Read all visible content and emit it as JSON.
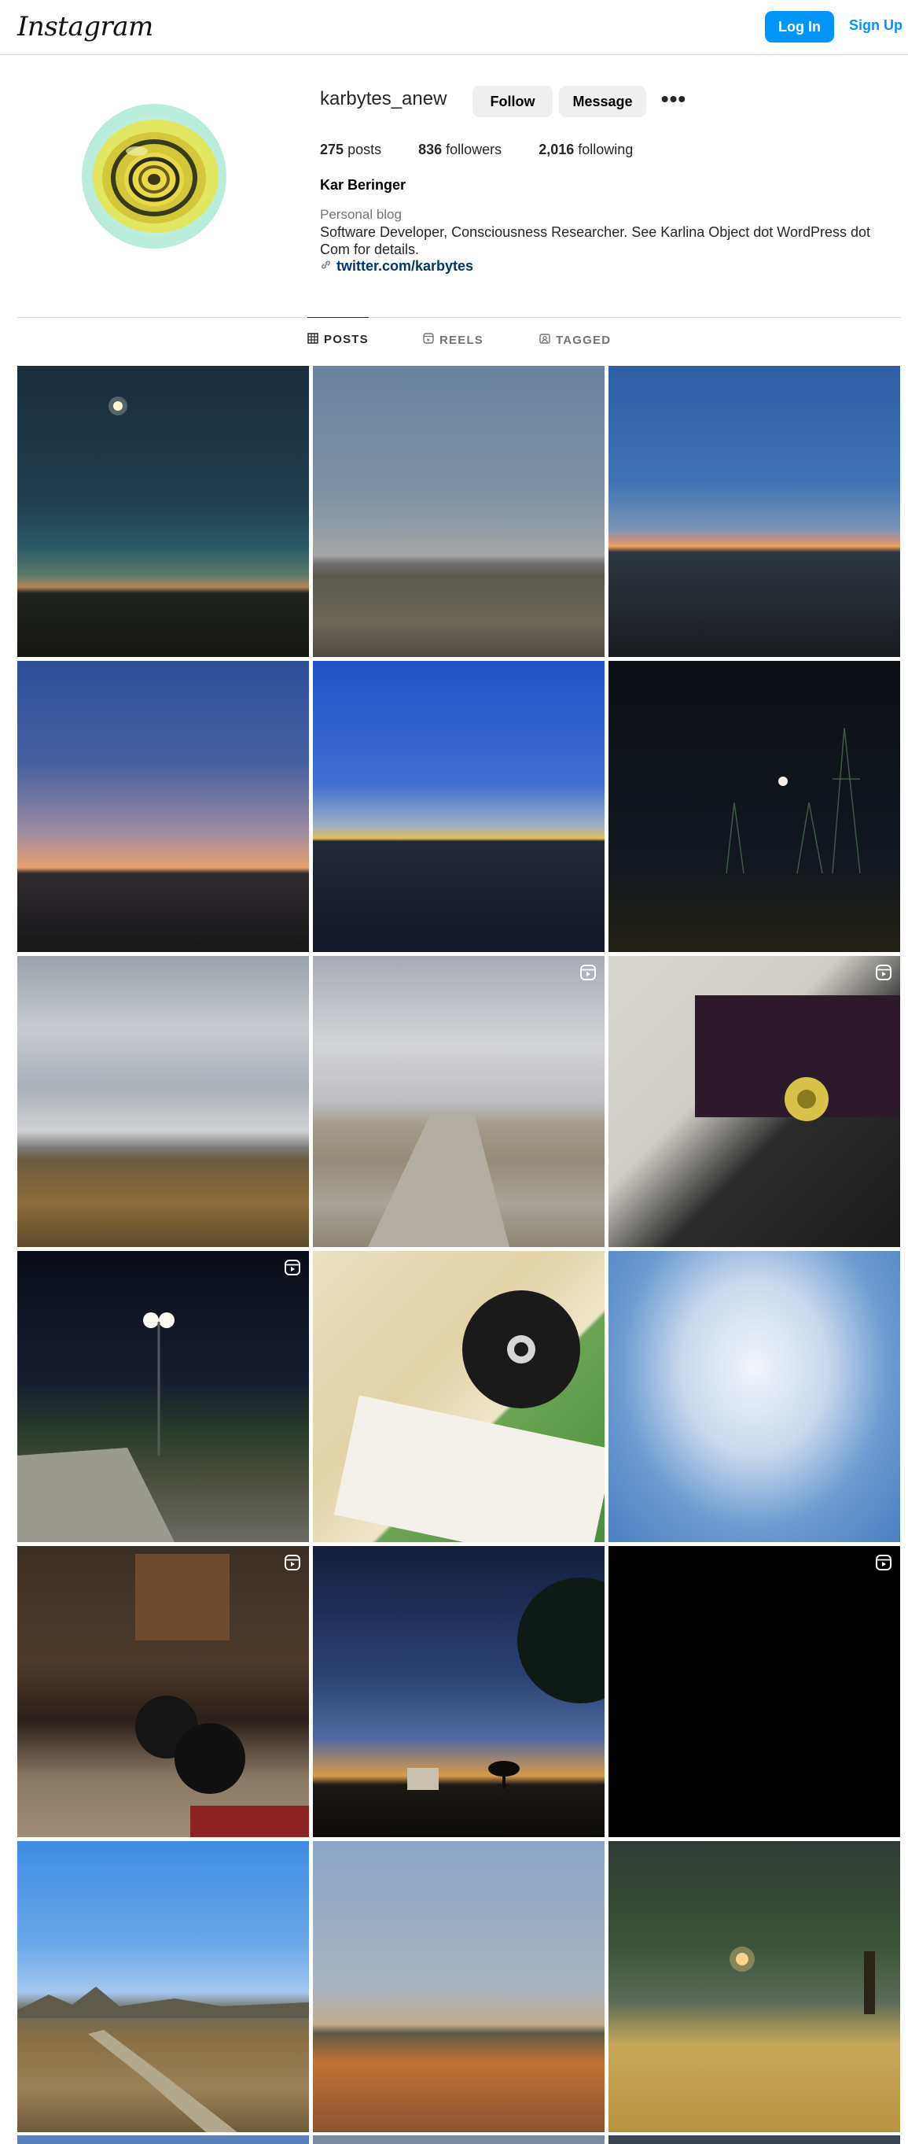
{
  "header": {
    "logo_text": "Instagram",
    "login_label": "Log In",
    "signup_label": "Sign Up",
    "accent_color": "#0095f6"
  },
  "profile": {
    "username": "karbytes_anew",
    "follow_label": "Follow",
    "message_label": "Message",
    "more_icon": "more-horizontal-icon",
    "stats": {
      "posts_count": "275",
      "posts_label": "posts",
      "followers_count": "836",
      "followers_label": "followers",
      "following_count": "2,016",
      "following_label": "following"
    },
    "full_name": "Kar Beringer",
    "category": "Personal blog",
    "bio": "Software Developer, Consciousness Researcher. See Karlina Object dot WordPress dot Com for details.",
    "link": "twitter.com/karbytes"
  },
  "tabs": [
    {
      "label": "POSTS",
      "icon": "grid-icon",
      "active": true
    },
    {
      "label": "REELS",
      "icon": "reels-icon",
      "active": false
    },
    {
      "label": "TAGGED",
      "icon": "tagged-icon",
      "active": false
    }
  ],
  "posts": [
    {
      "scene": "night-sky-moon-horizon",
      "is_reel": false
    },
    {
      "scene": "dusk-field-mountains",
      "is_reel": false
    },
    {
      "scene": "blue-sky-sunset-horizon",
      "is_reel": false
    },
    {
      "scene": "sunset-gradient-horizon",
      "is_reel": false
    },
    {
      "scene": "blue-sky-golden-horizon",
      "is_reel": false
    },
    {
      "scene": "night-power-lines-moon",
      "is_reel": false
    },
    {
      "scene": "cloudy-sky-dry-fields",
      "is_reel": false
    },
    {
      "scene": "gravel-path-cloudy",
      "is_reel": true
    },
    {
      "scene": "laptop-screen-image",
      "is_reel": true
    },
    {
      "scene": "night-street-lights",
      "is_reel": true
    },
    {
      "scene": "m-disc-documents",
      "is_reel": false
    },
    {
      "scene": "blue-sky-clouds",
      "is_reel": false
    },
    {
      "scene": "drum-kit-room",
      "is_reel": true
    },
    {
      "scene": "twilight-tree-silhouette",
      "is_reel": false
    },
    {
      "scene": "black-frame",
      "is_reel": true
    },
    {
      "scene": "dirt-path-hills",
      "is_reel": false
    },
    {
      "scene": "sunset-orange-field",
      "is_reel": false
    },
    {
      "scene": "tree-canopy-streetlight",
      "is_reel": false
    }
  ]
}
